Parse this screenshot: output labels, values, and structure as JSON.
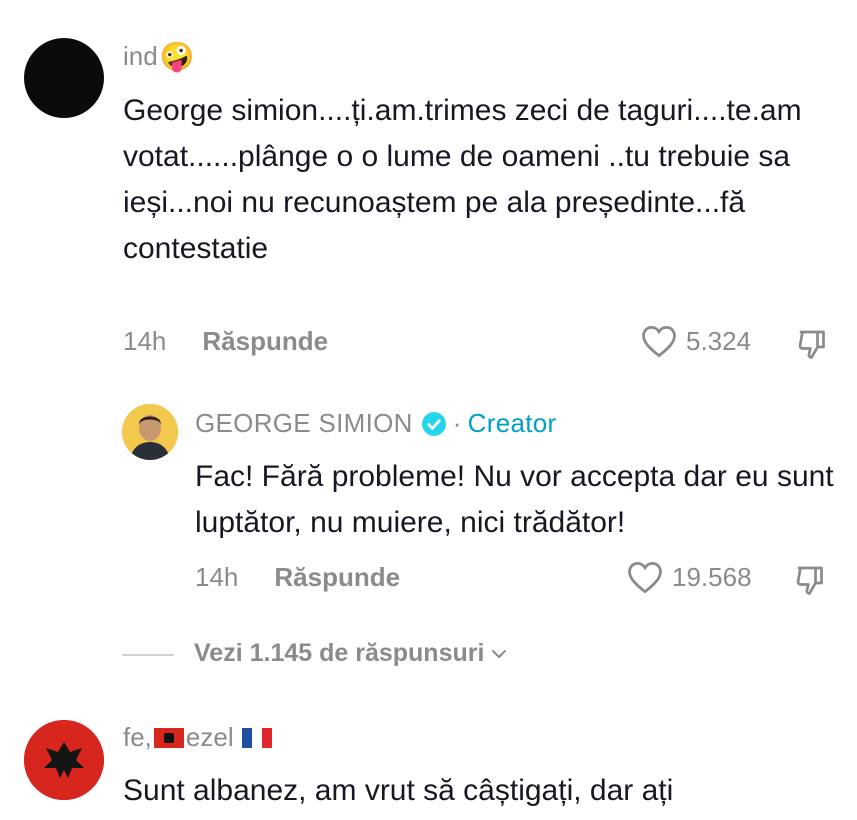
{
  "comment1": {
    "username": "ind",
    "emoji": "🤪",
    "text": "George simion....ți.am.trimes zeci de taguri....te.am votat......plânge o o lume de oameni ..tu trebuie sa ieși...noi nu recunoaștem pe ala președinte...fă contestatie",
    "time": "14h",
    "reply_label": "Răspunde",
    "likes": "5.324"
  },
  "reply1": {
    "username": "GEORGE SIMION",
    "dot": "·",
    "creator_label": "Creator",
    "text": "Fac! Fără probleme! Nu vor accepta dar eu sunt luptător, nu muiere, nici trădător!",
    "time": "14h",
    "reply_label": "Răspunde",
    "likes": "19.568"
  },
  "view_replies": {
    "label": "Vezi 1.145 de răspunsuri"
  },
  "comment2": {
    "username_part1": "fe,",
    "username_part2": "ezel",
    "text": "Sunt albanez, am vrut să câștigați, dar ați"
  },
  "colors": {
    "text_primary": "#161823",
    "text_secondary": "#8a8a8f",
    "creator": "#00a0c8",
    "verified": "#20d5ec"
  },
  "icons": [
    "heart-icon",
    "dislike-icon",
    "verified-icon",
    "chevron-down-icon"
  ]
}
